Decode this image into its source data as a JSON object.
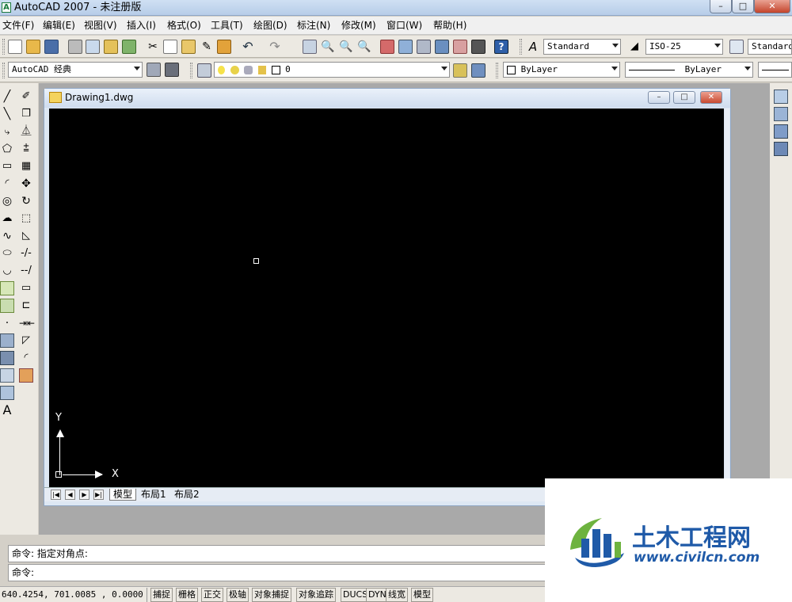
{
  "window": {
    "title": "AutoCAD 2007 - 未注册版",
    "min": "–",
    "max": "□",
    "close": "✕"
  },
  "menu": [
    "文件(F)",
    "编辑(E)",
    "视图(V)",
    "插入(I)",
    "格式(O)",
    "工具(T)",
    "绘图(D)",
    "标注(N)",
    "修改(M)",
    "窗口(W)",
    "帮助(H)"
  ],
  "toolbar": {
    "text_style": "Standard",
    "dim_style": "ISO-25",
    "table_style": "Standard",
    "workspace": "AutoCAD 经典",
    "layer": "0",
    "color": "ByLayer",
    "linetype": "ByLayer"
  },
  "document": {
    "title": "Drawing1.dwg",
    "axis_y": "Y",
    "axis_x": "X",
    "tabs": [
      "模型",
      "布局1",
      "布局2"
    ],
    "active_tab": "模型"
  },
  "command": {
    "line1": "命令: 指定对角点:",
    "line2": "命令:"
  },
  "status": {
    "coords": "640.4254,  701.0085 , 0.0000",
    "buttons": [
      "捕捉",
      "栅格",
      "正交",
      "极轴",
      "对象捕捉",
      "对象追踪",
      "DUCS",
      "DYN",
      "线宽",
      "模型"
    ]
  },
  "watermark": {
    "name": "土木工程网",
    "url": "www.civilcn.com"
  },
  "colors": {
    "canvas": "#000000",
    "accent": "#1f5aa8",
    "logo_green": "#6db33f"
  },
  "icons": {
    "left_tool_a": "A"
  }
}
